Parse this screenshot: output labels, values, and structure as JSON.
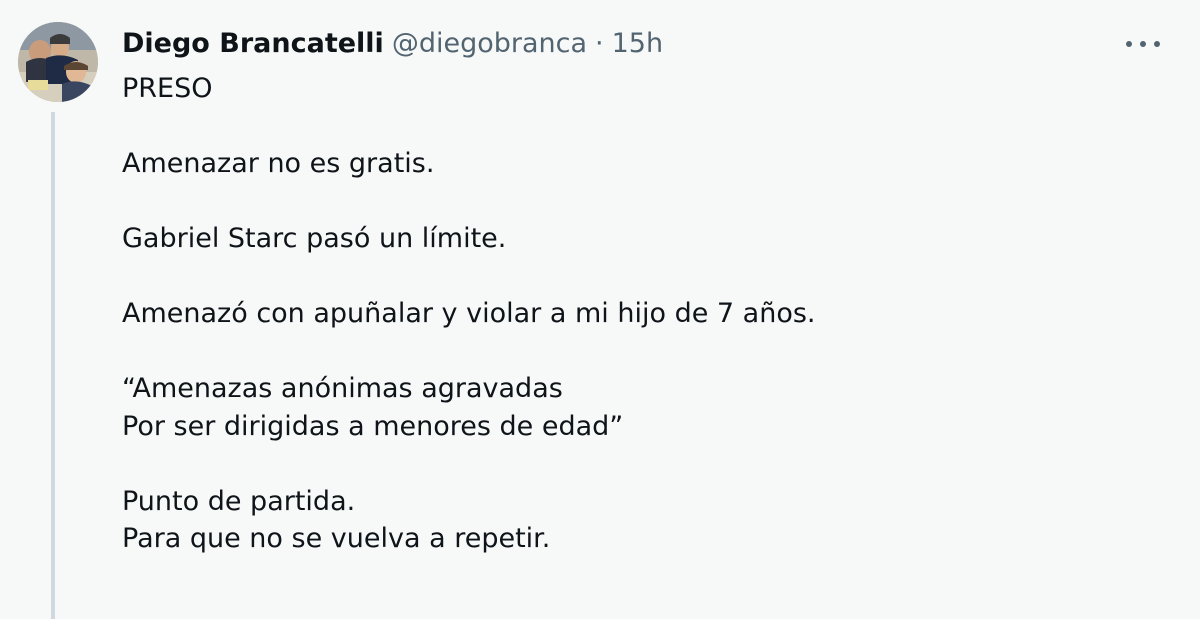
{
  "tweet": {
    "author_name": "Diego Brancatelli",
    "author_handle": "@diegobranca",
    "separator": "·",
    "time": "15h",
    "lines": [
      "PRESO",
      "",
      "Amenazar no es gratis.",
      "",
      "Gabriel Starc pasó un límite.",
      "",
      "Amenazó con apuñalar y violar a mi hijo de 7 años.",
      "",
      "“Amenazas anónimas agravadas",
      "Por ser dirigidas a menores de edad”",
      "",
      "Punto de partida.",
      "Para que no se vuelva a repetir."
    ]
  },
  "colors": {
    "background": "#f7f9f9",
    "text_primary": "#0f1419",
    "text_secondary": "#536471",
    "thread_line": "#cfd9de"
  },
  "icons": {
    "avatar": "profile-photo",
    "more": "more-horizontal-icon"
  }
}
